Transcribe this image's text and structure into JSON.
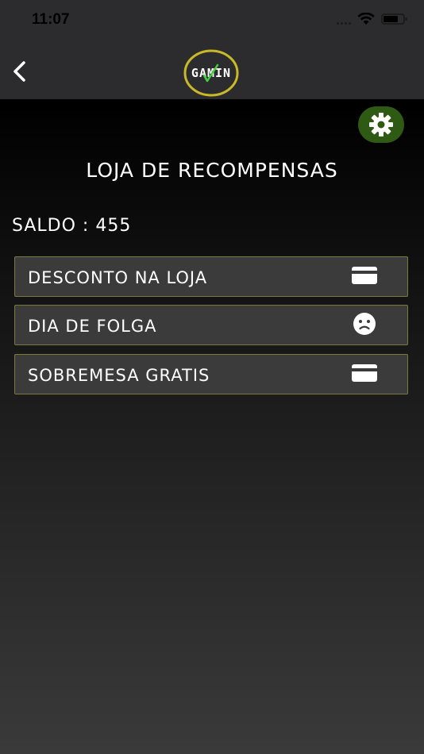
{
  "status": {
    "time": "11:07"
  },
  "header": {
    "logo_text": "GAMIN"
  },
  "page": {
    "title": "LOJA DE RECOMPENSAS",
    "saldo_label": "SALDO : 455"
  },
  "items": [
    {
      "label": "DESCONTO NA LOJA",
      "icon": "credit-card-icon"
    },
    {
      "label": "DIA DE FOLGA",
      "icon": "sad-face-icon"
    },
    {
      "label": "SOBREMESA GRATIS",
      "icon": "credit-card-icon"
    }
  ],
  "colors": {
    "accent_green": "#2f5a14",
    "logo_ring": "#c9b827",
    "logo_check": "#3fd23f",
    "item_border": "#7a7a3c",
    "item_bg": "#3b3b3b",
    "bar_bg": "#2c2c2e"
  }
}
